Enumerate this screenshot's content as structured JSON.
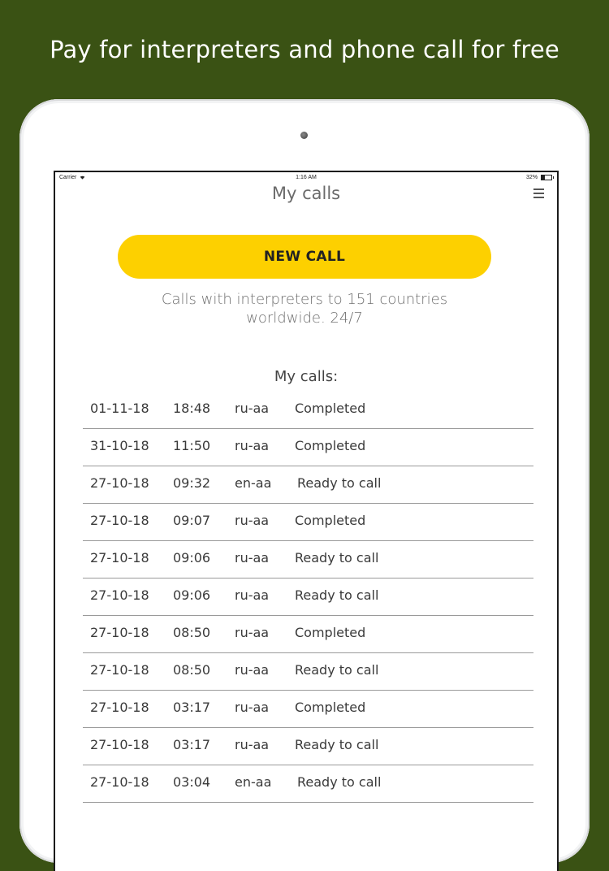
{
  "banner": {
    "text": "Pay for interpreters and phone call for free"
  },
  "statusbar": {
    "carrier": "Carrier",
    "time": "1:16 AM",
    "battery": "32%"
  },
  "header": {
    "title": "My calls"
  },
  "main": {
    "new_call_label": "NEW CALL",
    "tagline_line1": "Calls with interpreters to 151 countries",
    "tagline_line2": "worldwide. 24/7",
    "calls_heading": "My calls:"
  },
  "calls": [
    {
      "date": "01-11-18",
      "time": "18:48",
      "lang": "ru-aa",
      "status": "Completed"
    },
    {
      "date": "31-10-18",
      "time": "11:50",
      "lang": "ru-aa",
      "status": "Completed"
    },
    {
      "date": "27-10-18",
      "time": "09:32",
      "lang": "en-aa",
      "status": "Ready to call"
    },
    {
      "date": "27-10-18",
      "time": "09:07",
      "lang": "ru-aa",
      "status": "Completed"
    },
    {
      "date": "27-10-18",
      "time": "09:06",
      "lang": "ru-aa",
      "status": "Ready to call"
    },
    {
      "date": "27-10-18",
      "time": "09:06",
      "lang": "ru-aa",
      "status": "Ready to call"
    },
    {
      "date": "27-10-18",
      "time": "08:50",
      "lang": "ru-aa",
      "status": "Completed"
    },
    {
      "date": "27-10-18",
      "time": "08:50",
      "lang": "ru-aa",
      "status": "Ready to call"
    },
    {
      "date": "27-10-18",
      "time": "03:17",
      "lang": "ru-aa",
      "status": "Completed"
    },
    {
      "date": "27-10-18",
      "time": "03:17",
      "lang": "ru-aa",
      "status": "Ready to call"
    },
    {
      "date": "27-10-18",
      "time": "03:04",
      "lang": "en-aa",
      "status": "Ready to call"
    }
  ],
  "colors": {
    "background": "#3a5214",
    "button": "#fdd000"
  },
  "icons": {
    "menu": "hamburger-menu-icon",
    "wifi": "wifi-icon",
    "battery": "battery-icon"
  }
}
